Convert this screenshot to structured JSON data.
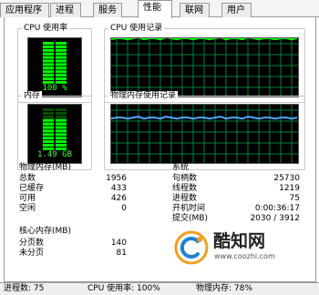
{
  "tabs": [
    {
      "label": "应用程序",
      "active": false
    },
    {
      "label": "进程",
      "active": false
    },
    {
      "label": "服务",
      "active": false
    },
    {
      "label": "性能",
      "active": true
    },
    {
      "label": "联网",
      "active": false
    },
    {
      "label": "用户",
      "active": false
    }
  ],
  "cpu_usage": {
    "label": "CPU 使用率",
    "value": "100 %",
    "level": 1.0
  },
  "cpu_history": {
    "label": "CPU 使用记录"
  },
  "memory": {
    "label": "内存",
    "value": "1.49 GB",
    "level": 0.78
  },
  "memory_history": {
    "label": "物理内存使用记录"
  },
  "physical_memory": {
    "label": "物理内存(MB)",
    "rows": [
      {
        "key": "总数",
        "value": "1956"
      },
      {
        "key": "已缓存",
        "value": "433"
      },
      {
        "key": "可用",
        "value": "426"
      },
      {
        "key": "空闲",
        "value": "0"
      }
    ]
  },
  "kernel_memory": {
    "label": "核心内存(MB)",
    "rows": [
      {
        "key": "分页数",
        "value": "140"
      },
      {
        "key": "未分页",
        "value": "81"
      }
    ]
  },
  "system": {
    "label": "系统",
    "rows": [
      {
        "key": "句柄数",
        "value": "25730"
      },
      {
        "key": "线程数",
        "value": "1219"
      },
      {
        "key": "进程数",
        "value": "75"
      },
      {
        "key": "开机时间",
        "value": "0:00:36:17"
      },
      {
        "key": "提交(MB)",
        "value": "2030 / 3912"
      }
    ]
  },
  "status_bar": {
    "processes": "进程数: 75",
    "cpu": "CPU 使用率: 100%",
    "memory": "物理内存: 78%"
  },
  "watermark": {
    "brand": "酷知网",
    "url": "www.coozhi.com"
  },
  "colors": {
    "graph_bg": "#000000",
    "grid": "#008040",
    "meter": "#00ff00",
    "cpu_line": "#00ff00",
    "mem_line": "#4fa8ff"
  }
}
